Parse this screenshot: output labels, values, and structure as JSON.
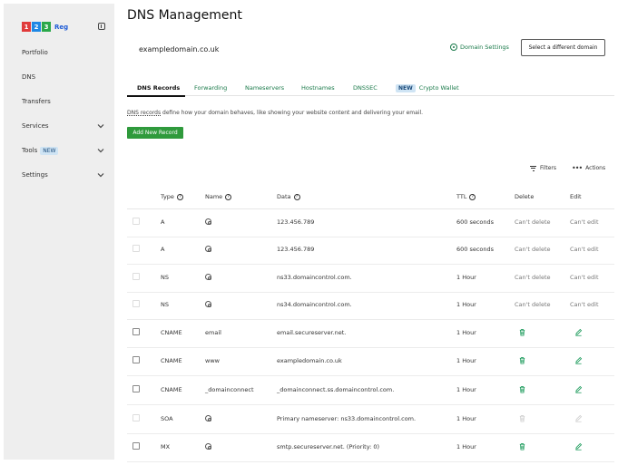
{
  "sidebar": {
    "logo": {
      "digits": [
        "1",
        "2",
        "3"
      ],
      "text": "Reg",
      "digit_colors": [
        "#e03a3a",
        "#1e88e5",
        "#2aa84a"
      ]
    },
    "items": [
      {
        "label": "Portfolio"
      },
      {
        "label": "DNS"
      },
      {
        "label": "Transfers"
      },
      {
        "label": "Services",
        "icon": "chevron-down-icon"
      },
      {
        "label": "Tools",
        "badge": "NEW",
        "icon": "chevron-down-icon"
      },
      {
        "label": "Settings",
        "icon": "chevron-down-icon"
      }
    ]
  },
  "header": {
    "title": "DNS Management",
    "domain": "exampledomain.co.uk",
    "domain_settings": "Domain Settings",
    "select_domain": "Select a different domain"
  },
  "tabs": [
    {
      "label": "DNS Records",
      "active": true
    },
    {
      "label": "Forwarding"
    },
    {
      "label": "Nameservers"
    },
    {
      "label": "Hostnames"
    },
    {
      "label": "DNSSEC"
    },
    {
      "label": "Crypto Wallet",
      "badge": "NEW"
    }
  ],
  "description": {
    "link": "DNS records",
    "rest": " define how your domain behaves, like showing your website content and delivering your email."
  },
  "add_button": "Add New Record",
  "toolbar": {
    "filters": "Filters",
    "actions": "Actions"
  },
  "table": {
    "headers": {
      "type": "Type",
      "name": "Name",
      "data": "Data",
      "ttl": "TTL",
      "delete": "Delete",
      "edit": "Edit"
    },
    "rows": [
      {
        "type": "A",
        "name": "@",
        "data": "123.456.789",
        "ttl": "600 seconds",
        "delete": "Can't delete",
        "edit": "Can't edit"
      },
      {
        "type": "A",
        "name": "@",
        "data": "123.456.789",
        "ttl": "600 seconds",
        "delete": "Can't delete",
        "edit": "Can't edit"
      },
      {
        "type": "NS",
        "name": "@",
        "data": "ns33.domaincontrol.com.",
        "ttl": "1 Hour",
        "delete": "Can't delete",
        "edit": "Can't edit"
      },
      {
        "type": "NS",
        "name": "@",
        "data": "ns34.domaincontrol.com.",
        "ttl": "1 Hour",
        "delete": "Can't delete",
        "edit": "Can't edit"
      },
      {
        "type": "CNAME",
        "name": "email",
        "data": "email.secureserver.net.",
        "ttl": "1 Hour",
        "delete": "trash-icon",
        "edit": "pencil-icon"
      },
      {
        "type": "CNAME",
        "name": "www",
        "data": "exampledomain.co.uk",
        "ttl": "1 Hour",
        "delete": "trash-icon",
        "edit": "pencil-icon"
      },
      {
        "type": "CNAME",
        "name": "_domainconnect",
        "data": "_domainconnect.ss.domaincontrol.com.",
        "ttl": "1 Hour",
        "delete": "trash-icon",
        "edit": "pencil-icon"
      },
      {
        "type": "SOA",
        "name": "@",
        "data": "Primary nameserver: ns33.domaincontrol.com.",
        "ttl": "1 Hour",
        "delete": "trash-icon-disabled",
        "edit": "pencil-icon-disabled"
      },
      {
        "type": "MX",
        "name": "@",
        "data": "smtp.secureserver.net. (Priority: 0)",
        "ttl": "1 Hour",
        "delete": "trash-icon",
        "edit": "pencil-icon"
      }
    ]
  },
  "colors": {
    "accent": "#1a7a4a",
    "button_green": "#2f9a3c",
    "sidebar_bg": "#eeeeee",
    "badge_bg": "#cfe4f4"
  }
}
